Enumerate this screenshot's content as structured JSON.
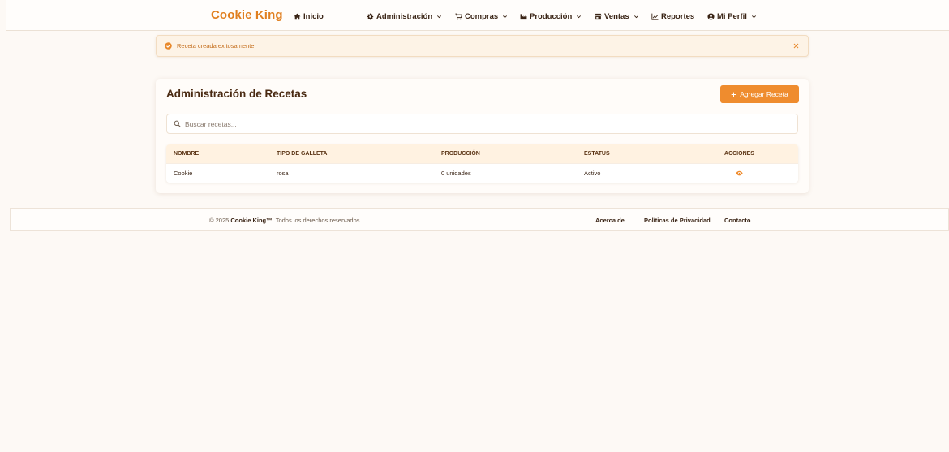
{
  "app": {
    "brand": "Cookie King"
  },
  "nav": [
    {
      "label": "Inicio",
      "icon": "home-icon",
      "dropdown": false
    },
    {
      "label": "Administración",
      "icon": "gear-icon",
      "dropdown": true
    },
    {
      "label": "Compras",
      "icon": "cart-icon",
      "dropdown": true
    },
    {
      "label": "Producción",
      "icon": "factory-icon",
      "dropdown": true
    },
    {
      "label": "Ventas",
      "icon": "store-icon",
      "dropdown": true
    },
    {
      "label": "Reportes",
      "icon": "line-chart-icon",
      "dropdown": false
    },
    {
      "label": "Mi Perfil",
      "icon": "user-circle-icon",
      "dropdown": true
    }
  ],
  "alert": {
    "message": "Receta creada exitosamente",
    "icon": "check-circle-icon",
    "close_icon": "close-icon"
  },
  "recipes": {
    "title": "Administración de Recetas",
    "add_button_label": "Agregar Receta",
    "add_button_icon": "plus-icon",
    "search_placeholder": "Buscar recetas...",
    "search_value": "",
    "search_icon": "search-icon"
  },
  "table": {
    "headers": [
      "NOMBRE",
      "TIPO DE GALLETA",
      "PRODUCCIÓN",
      "ESTATUS",
      "ACCIONES"
    ],
    "rows": [
      {
        "nombre": "Cookie",
        "tipo": "rosa",
        "produccion": "0 unidades",
        "estatus": "Activo",
        "action_icon": "eye-icon"
      }
    ]
  },
  "footer": {
    "copyright_prefix": "© 2025 ",
    "brand": "Cookie King™",
    "copyright_suffix": ". Todos los derechos reservados.",
    "links": [
      "Acerca de",
      "Políticas de Privacidad",
      "Contacto"
    ]
  },
  "colors": {
    "brand": "#e07f1f",
    "accent": "#ef8c2e",
    "heading": "#4a2a12",
    "table_header_bg": "#fff2e1",
    "page_bg": "#fdf9f5",
    "alert_bg": "#fdf3e6"
  }
}
